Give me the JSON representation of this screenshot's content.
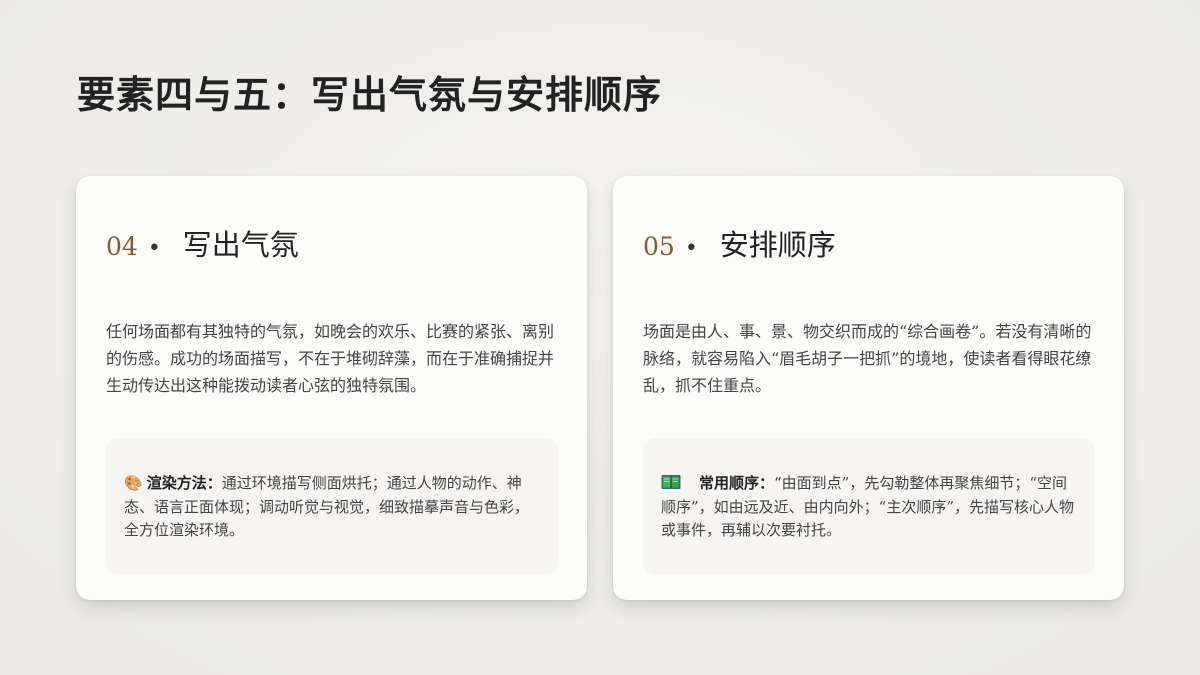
{
  "page": {
    "title": "要素四与五：写出气氛与安排顺序"
  },
  "cards": [
    {
      "number": "04",
      "dot": "•",
      "title": "写出气氛",
      "body": "任何场面都有其独特的气氛，如晚会的欢乐、比赛的紧张、离别的伤感。成功的场面描写，不在于堆砌辞藻，而在于准确捕捉并生动传达出这种能拨动读者心弦的独特氛围。",
      "note": {
        "icon": "palette-icon",
        "icon_glyph": "🎨",
        "label": "渲染方法：",
        "text": "通过环境描写侧面烘托；通过人物的动作、神态、语言正面体现；调动听觉与视觉，细致描摹声音与色彩，全方位渲染环境。"
      }
    },
    {
      "number": "05",
      "dot": "•",
      "title": "安排顺序",
      "body": "场面是由人、事、景、物交织而成的“综合画卷”。若没有清晰的脉络，就容易陷入“眉毛胡子一把抓”的境地，使读者看得眼花缭乱，抓不住重点。",
      "note": {
        "icon": "book-icon",
        "label": "常用顺序：",
        "text": "“由面到点”，先勾勒整体再聚焦细节；“空间顺序”，如由远及近、由内向外；“主次顺序”，先描写核心人物或事件，再辅以次要衬托。"
      }
    }
  ],
  "colors": {
    "accent_number": "#8a5a2b",
    "card_background": "#fcfcfb",
    "note_background": "#f6f5f3",
    "page_background": "#efeeec"
  }
}
